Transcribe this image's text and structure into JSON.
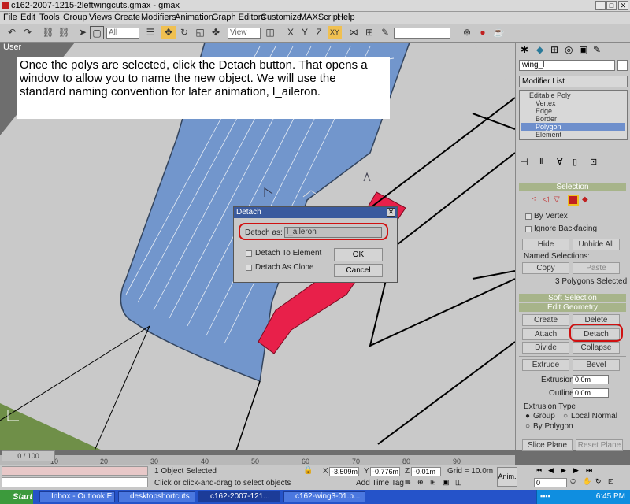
{
  "window": {
    "title": "c162-2007-1215-2leftwingcuts.gmax - gmax",
    "min": "_",
    "max": "□",
    "close": "✕"
  },
  "menu": [
    "File",
    "Edit",
    "Tools",
    "Group",
    "Views",
    "Create",
    "Modifiers",
    "Animation",
    "Graph Editors",
    "Customize",
    "MAXScript",
    "Help"
  ],
  "toolbar": {
    "filter_value": "All",
    "refcoord_value": "View"
  },
  "viewport": {
    "label": "User"
  },
  "caption": "Once the polys are selected, click the Detach button.  That opens a\nwindow to allow you to name the new object.  We will use the\nstandard naming convention for later animation, l_aileron.",
  "detach_dialog": {
    "title": "Detach",
    "close": "✕",
    "detach_as_label": "Detach as:",
    "detach_as_value": "l_aileron",
    "detach_to_element": "Detach To Element",
    "detach_as_clone": "Detach As Clone",
    "ok": "OK",
    "cancel": "Cancel"
  },
  "panel": {
    "object_name": "wing_l",
    "modifier_list": "Modifier List",
    "stack": [
      "Editable Poly",
      "Vertex",
      "Edge",
      "Border",
      "Polygon",
      "Element"
    ],
    "selected_stack_item": "Polygon",
    "selection": {
      "header": "Selection",
      "by_vertex": "By Vertex",
      "ignore_backfacing": "Ignore Backfacing",
      "hide": "Hide",
      "unhide_all": "Unhide All",
      "named_selections": "Named Selections:",
      "copy": "Copy",
      "paste": "Paste",
      "status": "3 Polygons Selected"
    },
    "soft_selection": "Soft Selection",
    "edit_geometry": {
      "header": "Edit Geometry",
      "create": "Create",
      "delete": "Delete",
      "attach": "Attach",
      "detach": "Detach",
      "divide": "Divide",
      "collapse": "Collapse",
      "extrude": "Extrude",
      "bevel": "Bevel",
      "extrusion_label": "Extrusion:",
      "extrusion_value": "0.0m",
      "outline_label": "Outline",
      "outline_value": "0.0m",
      "extrusion_type": "Extrusion Type",
      "group": "Group",
      "local_normal": "Local Normal",
      "by_polygon": "By Polygon",
      "slice_plane": "Slice Plane",
      "reset_plane": "Reset Plane"
    }
  },
  "timeline": {
    "slider": "0 / 100",
    "ticks": [
      "10",
      "20",
      "30",
      "40",
      "50",
      "60",
      "70",
      "80",
      "90"
    ]
  },
  "status": {
    "selected": "1 Object Selected",
    "prompt": "Click or click-and-drag to select objects",
    "x": "-3.509m",
    "y": "-0.776m",
    "z": "-0.01m",
    "grid": "Grid = 10.0m",
    "add_time_tag": "Add Time Tag",
    "anim": "Anim.",
    "frame": "0"
  },
  "taskbar": {
    "start": "Start",
    "tasks": [
      "Inbox - Outlook E...",
      "desktopshortcuts",
      "c162-2007-121...",
      "c162-wing3-01.b..."
    ],
    "active_task": 2,
    "clock": "6:45 PM"
  },
  "colors": {
    "selection_red": "#e8204a",
    "callout_red": "#d01010",
    "mesh_blue": "#6f93c8",
    "rollout_green": "#a7b48a"
  }
}
